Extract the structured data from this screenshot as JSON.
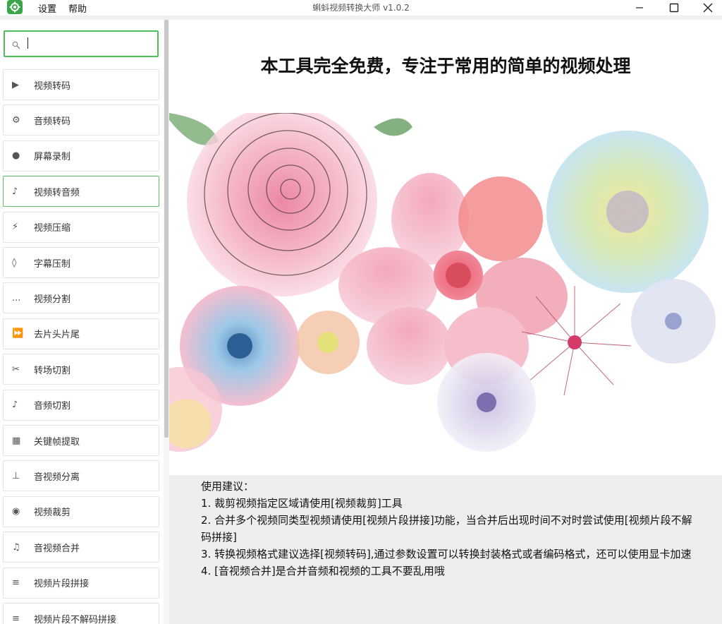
{
  "window": {
    "title": "蝌蚪视频转换大师 v1.0.2",
    "menu": [
      "设置",
      "帮助"
    ]
  },
  "search": {
    "placeholder": "",
    "value": ""
  },
  "sidebar": {
    "items": [
      {
        "label": "视频转码",
        "icon": "play-icon",
        "glyph": "▶"
      },
      {
        "label": "音频转码",
        "icon": "gear-icon",
        "glyph": "⚙"
      },
      {
        "label": "屏幕录制",
        "icon": "record-icon",
        "glyph": "●"
      },
      {
        "label": "视频转音频",
        "icon": "music-note-icon",
        "glyph": "♪",
        "active": true
      },
      {
        "label": "视频压缩",
        "icon": "lightning-icon",
        "glyph": "⚡"
      },
      {
        "label": "字幕压制",
        "icon": "diamond-icon",
        "glyph": "◊"
      },
      {
        "label": "视频分割",
        "icon": "ellipsis-icon",
        "glyph": "..."
      },
      {
        "label": "去片头片尾",
        "icon": "fast-forward-icon",
        "glyph": "⏩"
      },
      {
        "label": "转场切割",
        "icon": "scissors-icon",
        "glyph": "✂"
      },
      {
        "label": "音频切割",
        "icon": "music-note-icon",
        "glyph": "♪"
      },
      {
        "label": "关键帧提取",
        "icon": "grid-icon",
        "glyph": "▦"
      },
      {
        "label": "音视频分离",
        "icon": "split-icon",
        "glyph": "⊥"
      },
      {
        "label": "视频裁剪",
        "icon": "target-icon",
        "glyph": "◉"
      },
      {
        "label": "音视频合并",
        "icon": "music-notes-icon",
        "glyph": "♫"
      },
      {
        "label": "视频片段拼接",
        "icon": "lines-icon",
        "glyph": "≡"
      },
      {
        "label": "视频片段不解码拼接",
        "icon": "lines-icon",
        "glyph": "≡"
      }
    ]
  },
  "main": {
    "headline": "本工具完全免费，专注于常用的简单的视频处理",
    "tips": [
      "使用建议：",
      "1. 裁剪视频指定区域请使用[视频裁剪]工具",
      "2. 合并多个视频同类型视频请使用[视频片段拼接]功能，当合并后出现时间不对时尝试使用[视频片段不解码拼接]",
      "3. 转换视频格式建议选择[视频转码],通过参数设置可以转换封装格式或者编码格式，还可以使用显卡加速",
      "4. [音视频合并]是合并音频和视频的工具不要乱用哦"
    ]
  },
  "colors": {
    "accent": "#4cbf5a",
    "logo": "#3aa64a",
    "tips_bg": "#eeeeee"
  }
}
